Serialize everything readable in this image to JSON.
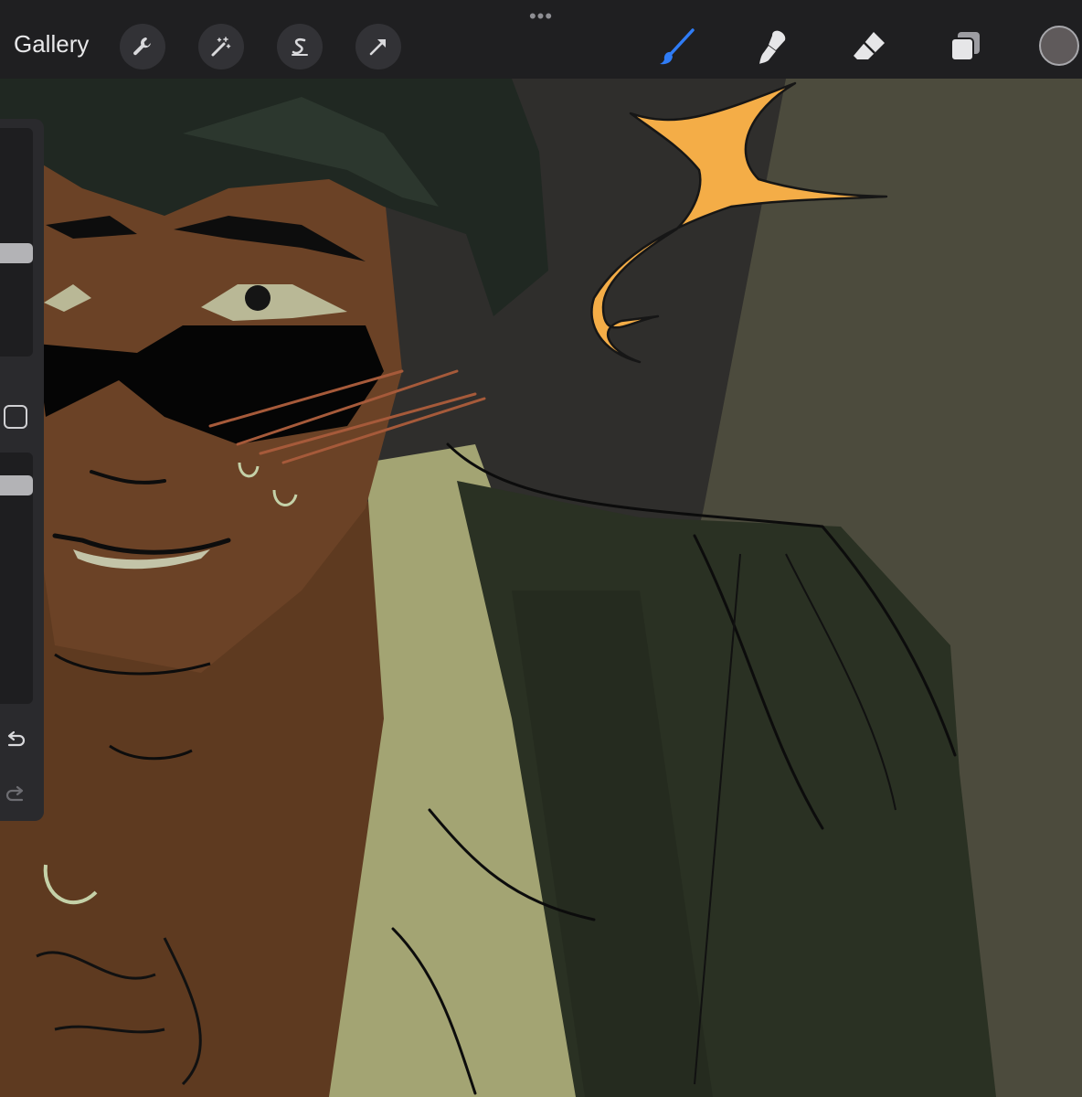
{
  "toolbar": {
    "gallery_label": "Gallery",
    "more_glyph": "•••",
    "left_tools": [
      "wrench-icon",
      "magic-wand-icon",
      "selection-s-icon",
      "transform-arrow-icon"
    ],
    "right_tools": [
      "brush-icon",
      "smudge-icon",
      "eraser-icon",
      "layers-icon"
    ],
    "active_tool": "brush-icon",
    "active_color": "#5f5a5b",
    "accent_color": "#2f7cf6"
  },
  "sidebar": {
    "brush_size_level": 0.55,
    "opacity_level": 0.95,
    "buttons": [
      "undo-icon",
      "redo-icon"
    ]
  },
  "canvas": {
    "artwork": "illustration-of-man-with-sunglasses",
    "background_colors": [
      "#2f2e2c",
      "#4c4b3d"
    ],
    "highlight_color": "#f4ad47"
  }
}
